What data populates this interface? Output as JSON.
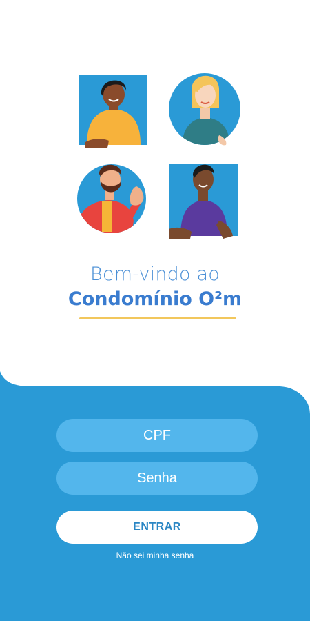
{
  "welcome": {
    "greeting": "Bem-vindo ao",
    "brand": "Condomínio O²m"
  },
  "form": {
    "cpf_placeholder": "CPF",
    "password_placeholder": "Senha",
    "submit_label": "ENTRAR",
    "forgot_label": "Não sei minha senha"
  },
  "colors": {
    "primary_blue": "#2a9ad6",
    "field_blue": "#53b6ec",
    "accent_gold": "#f2c75c",
    "title_blue": "#3a7ccf"
  }
}
